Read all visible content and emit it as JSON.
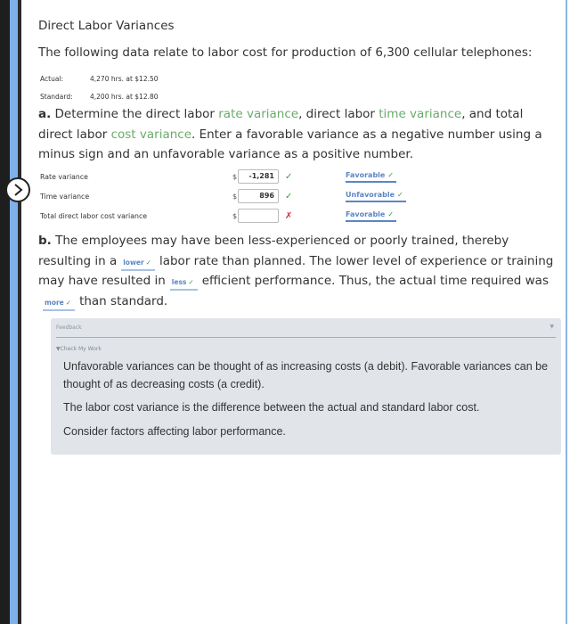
{
  "title": "Direct Labor Variances",
  "intro": "The following data relate to labor cost for production of 6,300 cellular telephones:",
  "data_rows": [
    {
      "label": "Actual:",
      "value": "4,270 hrs. at $12.50"
    },
    {
      "label": "Standard:",
      "value": "4,200 hrs. at $12.80"
    }
  ],
  "part_a": {
    "letter": "a.",
    "text_1": " Determine the direct labor ",
    "term_1": "rate variance",
    "text_2": ", direct labor ",
    "term_2": "time variance",
    "text_3": ", and total direct labor ",
    "term_3": "cost variance",
    "text_4": ". Enter a favorable variance as a negative number using a minus sign and an unfavorable variance as a positive number."
  },
  "variances": [
    {
      "label": "Rate variance",
      "currency": "$",
      "value": "-1,281",
      "mark": "✓",
      "status": "correct",
      "type": "Favorable",
      "type_mark": "✓"
    },
    {
      "label": "Time variance",
      "currency": "$",
      "value": "896",
      "mark": "✓",
      "status": "correct",
      "type": "Unfavorable",
      "type_mark": "✓"
    },
    {
      "label": "Total direct labor cost variance",
      "currency": "$",
      "value": "",
      "mark": "✗",
      "status": "incorrect",
      "type": "Favorable",
      "type_mark": "✓"
    }
  ],
  "part_b": {
    "letter": "b.",
    "text_1": " The employees may have been less-experienced or poorly trained, thereby resulting in a",
    "select_1": "lower",
    "text_2": "labor rate than planned. The lower level of experience or training may have resulted in",
    "select_2": "less",
    "text_3": "efficient performance. Thus, the actual time required was",
    "select_3": "more",
    "text_4": "than standard.",
    "check": "✓"
  },
  "feedback": {
    "header": "Feedback",
    "caret": "▼",
    "check_my_work": "▼Check My Work",
    "paragraphs": [
      "Unfavorable variances can be thought of as increasing costs (a debit). Favorable variances can be thought of as decreasing costs (a credit).",
      "The labor cost variance is the difference between the actual and standard labor cost.",
      "Consider factors affecting labor performance."
    ]
  },
  "colors": {
    "term_green": "#6aab6a",
    "dropdown_blue": "#5b86c4",
    "check_green": "#3a9a3a",
    "error_red": "#d03030",
    "feedback_bg": "#e1e5ea"
  }
}
